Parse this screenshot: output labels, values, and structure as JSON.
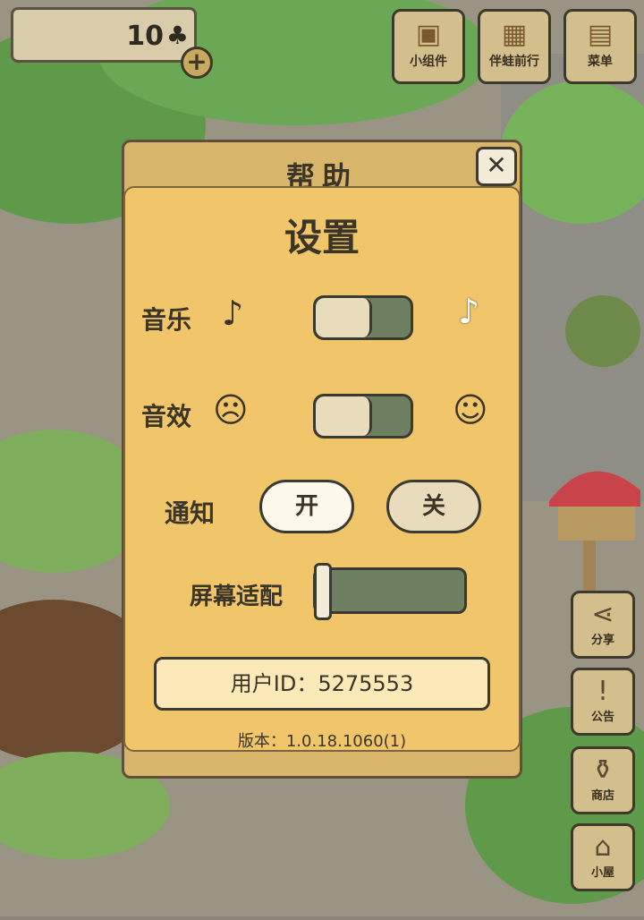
{
  "hud": {
    "clover_count": "10",
    "clover_symbol": "♣",
    "plus_symbol": "+"
  },
  "top_buttons": [
    {
      "label": "小组件",
      "icon": "widget-icon"
    },
    {
      "label": "伴蛙前行",
      "icon": "album-icon"
    },
    {
      "label": "菜单",
      "icon": "menu-icon"
    }
  ],
  "side_buttons": [
    {
      "label": "分享",
      "icon": "share-icon"
    },
    {
      "label": "公告",
      "icon": "notice-icon"
    },
    {
      "label": "商店",
      "icon": "shop-icon"
    },
    {
      "label": "小屋",
      "icon": "house-icon"
    }
  ],
  "dialog": {
    "back_title": "帮助",
    "close_symbol": "✕",
    "title": "设置",
    "music_label": "音乐",
    "sound_label": "音效",
    "notify_label": "通知",
    "notify_on": "开",
    "notify_off": "关",
    "screen_label": "屏幕适配",
    "user_id": "用户ID：5275553",
    "version": "版本：1.0.18.1060(1)"
  },
  "colors": {
    "panel": "#f1c56a",
    "toggle_track": "#6e7f62",
    "knob": "#e8dcbc"
  }
}
